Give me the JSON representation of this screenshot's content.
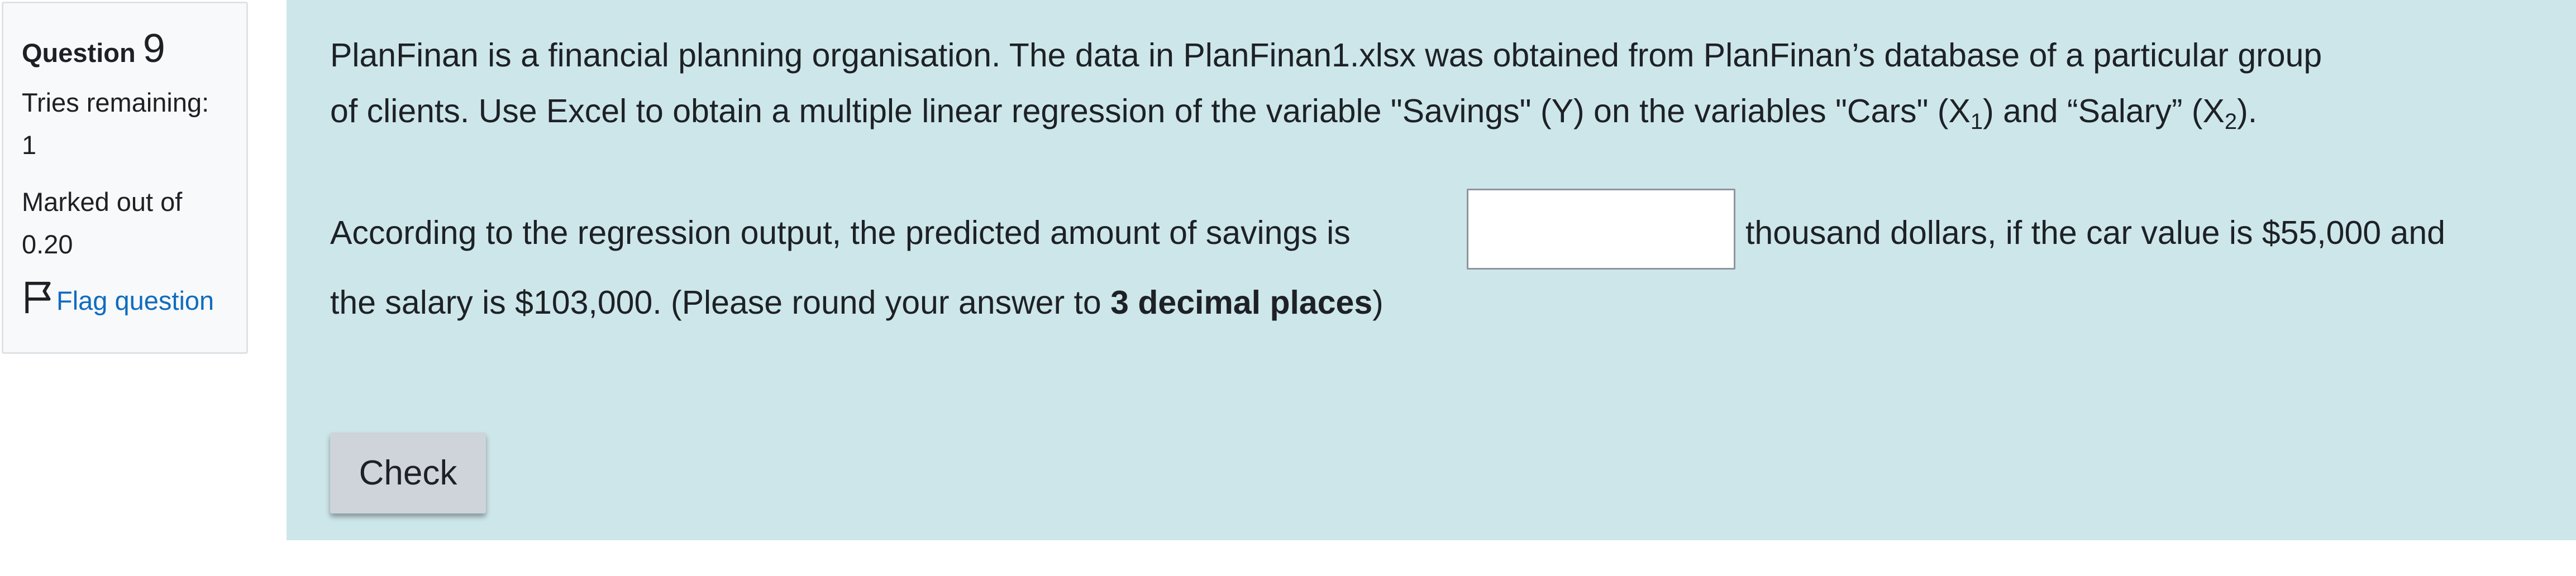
{
  "info": {
    "question_word": "Question",
    "question_number": "9",
    "tries_remaining_label": "Tries remaining:",
    "tries_remaining_value": "1",
    "marked_out_of_label": "Marked out of",
    "marked_out_of_value": "0.20",
    "flag_label": "Flag question"
  },
  "question": {
    "line1": "PlanFinan is a financial planning organisation. The data in PlanFinan1.xlsx was obtained from PlanFinan’s database of a particular group",
    "line2_part1": "of clients. Use Excel to obtain a multiple linear regression of the variable \"Savings\" (Y) on the variables \"Cars\" (X",
    "x1_subscript": "1",
    "line2_part2": ") and “Salary” (X",
    "x2_subscript": "2",
    "line2_part3": ").",
    "line3_before": "According to the regression output, the predicted amount of savings is",
    "line3_after": "thousand dollars, if the car value is $55,000 and",
    "line4_start": "the salary is $103,000.  (Please round your answer to ",
    "line4_bold": "3 decimal places",
    "line4_end": ")",
    "answer_value": ""
  },
  "actions": {
    "check_label": "Check"
  },
  "colors": {
    "content_bg": "#cde6ea",
    "info_bg": "#f8f9fa",
    "link": "#0f6cbf",
    "button_bg": "#ced4da"
  }
}
